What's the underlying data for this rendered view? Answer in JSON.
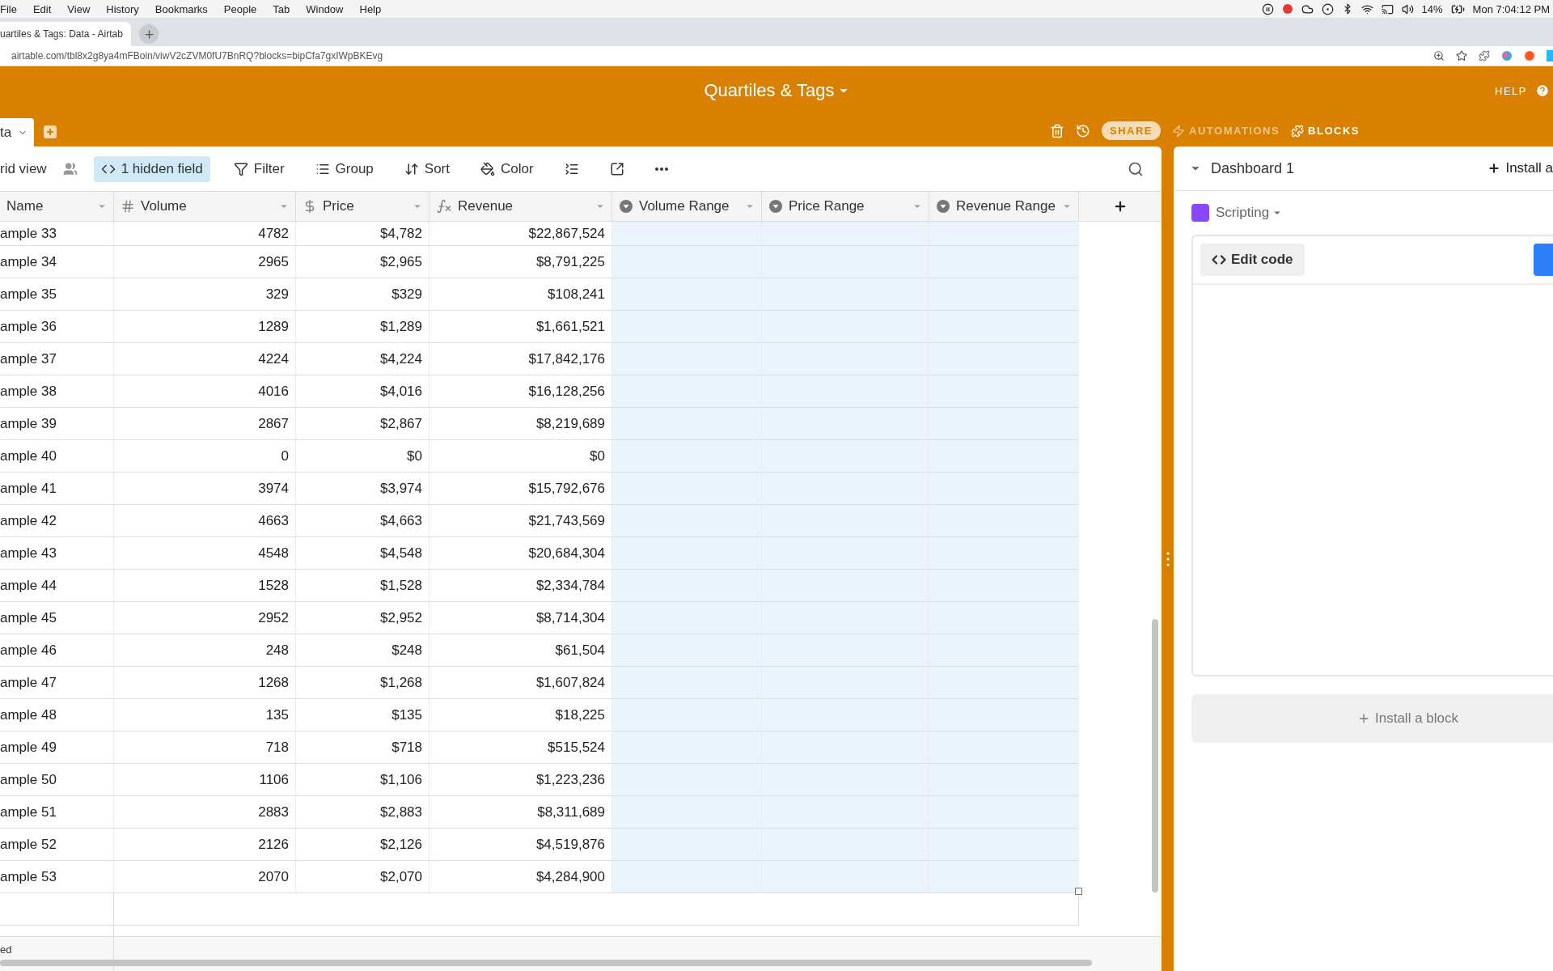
{
  "menu_bar": {
    "items": [
      "File",
      "Edit",
      "View",
      "History",
      "Bookmarks",
      "People",
      "Tab",
      "Window",
      "Help"
    ],
    "battery": "14%",
    "clock": "Mon 7:04:12 PM"
  },
  "browser": {
    "tab_title": "uartiles & Tags: Data - Airtab",
    "url": "airtable.com/tbl8x2g8ya4mFBoin/viwV2cZVM0fU7BnRQ?blocks=bipCfa7gxIWpBKEvg"
  },
  "header": {
    "title": "Quartiles & Tags",
    "help": "HELP",
    "table_tab": "ta",
    "actions": [
      {
        "kind": "trash"
      },
      {
        "kind": "history"
      },
      {
        "kind": "share",
        "label": "SHARE"
      },
      {
        "kind": "automations",
        "label": "AUTOMATIONS",
        "dimmed": true
      },
      {
        "kind": "blocks",
        "label": "BLOCKS",
        "dimmed": false
      }
    ]
  },
  "toolbar": {
    "view": "rid view",
    "items": [
      {
        "kind": "hide",
        "label": "1 hidden field",
        "active": true
      },
      {
        "kind": "filter",
        "label": "Filter",
        "active": false
      },
      {
        "kind": "group",
        "label": "Group",
        "active": false
      },
      {
        "kind": "sort",
        "label": "Sort",
        "active": false
      },
      {
        "kind": "color",
        "label": "Color",
        "active": false
      },
      {
        "kind": "height",
        "active": false
      },
      {
        "kind": "share",
        "active": false
      },
      {
        "kind": "more",
        "active": false
      }
    ]
  },
  "table": {
    "columns": [
      {
        "label": "Name",
        "kind": "name",
        "selected": false
      },
      {
        "label": "Volume",
        "kind": "number",
        "selected": false
      },
      {
        "label": "Price",
        "kind": "currency",
        "selected": false
      },
      {
        "label": "Revenue",
        "kind": "formula",
        "selected": false
      },
      {
        "label": "Volume Range",
        "kind": "select",
        "selected": true
      },
      {
        "label": "Price Range",
        "kind": "select",
        "selected": true
      },
      {
        "label": "Revenue Range",
        "kind": "select",
        "selected": true
      }
    ],
    "rows": [
      {
        "cells": [
          "ample 33",
          "4782",
          "$4,782",
          "$22,867,524"
        ]
      },
      {
        "cells": [
          "ample 34",
          "2965",
          "$2,965",
          "$8,791,225"
        ]
      },
      {
        "cells": [
          "ample 35",
          "329",
          "$329",
          "$108,241"
        ]
      },
      {
        "cells": [
          "ample 36",
          "1289",
          "$1,289",
          "$1,661,521"
        ]
      },
      {
        "cells": [
          "ample 37",
          "4224",
          "$4,224",
          "$17,842,176"
        ]
      },
      {
        "cells": [
          "ample 38",
          "4016",
          "$4,016",
          "$16,128,256"
        ]
      },
      {
        "cells": [
          "ample 39",
          "2867",
          "$2,867",
          "$8,219,689"
        ]
      },
      {
        "cells": [
          "ample 40",
          "0",
          "$0",
          "$0"
        ]
      },
      {
        "cells": [
          "ample 41",
          "3974",
          "$3,974",
          "$15,792,676"
        ]
      },
      {
        "cells": [
          "ample 42",
          "4663",
          "$4,663",
          "$21,743,569"
        ]
      },
      {
        "cells": [
          "ample 43",
          "4548",
          "$4,548",
          "$20,684,304"
        ]
      },
      {
        "cells": [
          "ample 44",
          "1528",
          "$1,528",
          "$2,334,784"
        ]
      },
      {
        "cells": [
          "ample 45",
          "2952",
          "$2,952",
          "$8,714,304"
        ]
      },
      {
        "cells": [
          "ample 46",
          "248",
          "$248",
          "$61,504"
        ]
      },
      {
        "cells": [
          "ample 47",
          "1268",
          "$1,268",
          "$1,607,824"
        ]
      },
      {
        "cells": [
          "ample 48",
          "135",
          "$135",
          "$18,225"
        ]
      },
      {
        "cells": [
          "ample 49",
          "718",
          "$718",
          "$515,524"
        ]
      },
      {
        "cells": [
          "ample 50",
          "1106",
          "$1,106",
          "$1,223,236"
        ]
      },
      {
        "cells": [
          "ample 51",
          "2883",
          "$2,883",
          "$8,311,689"
        ]
      },
      {
        "cells": [
          "ample 52",
          "2126",
          "$2,126",
          "$4,519,876"
        ]
      },
      {
        "cells": [
          "ample 53",
          "2070",
          "$2,070",
          "$4,284,900"
        ]
      }
    ],
    "footer": "ed"
  },
  "dashboard": {
    "title": "Dashboard 1",
    "install_top": "Install a",
    "block_name": "Scripting",
    "edit_code": "Edit code",
    "install_block": "Install a block"
  }
}
